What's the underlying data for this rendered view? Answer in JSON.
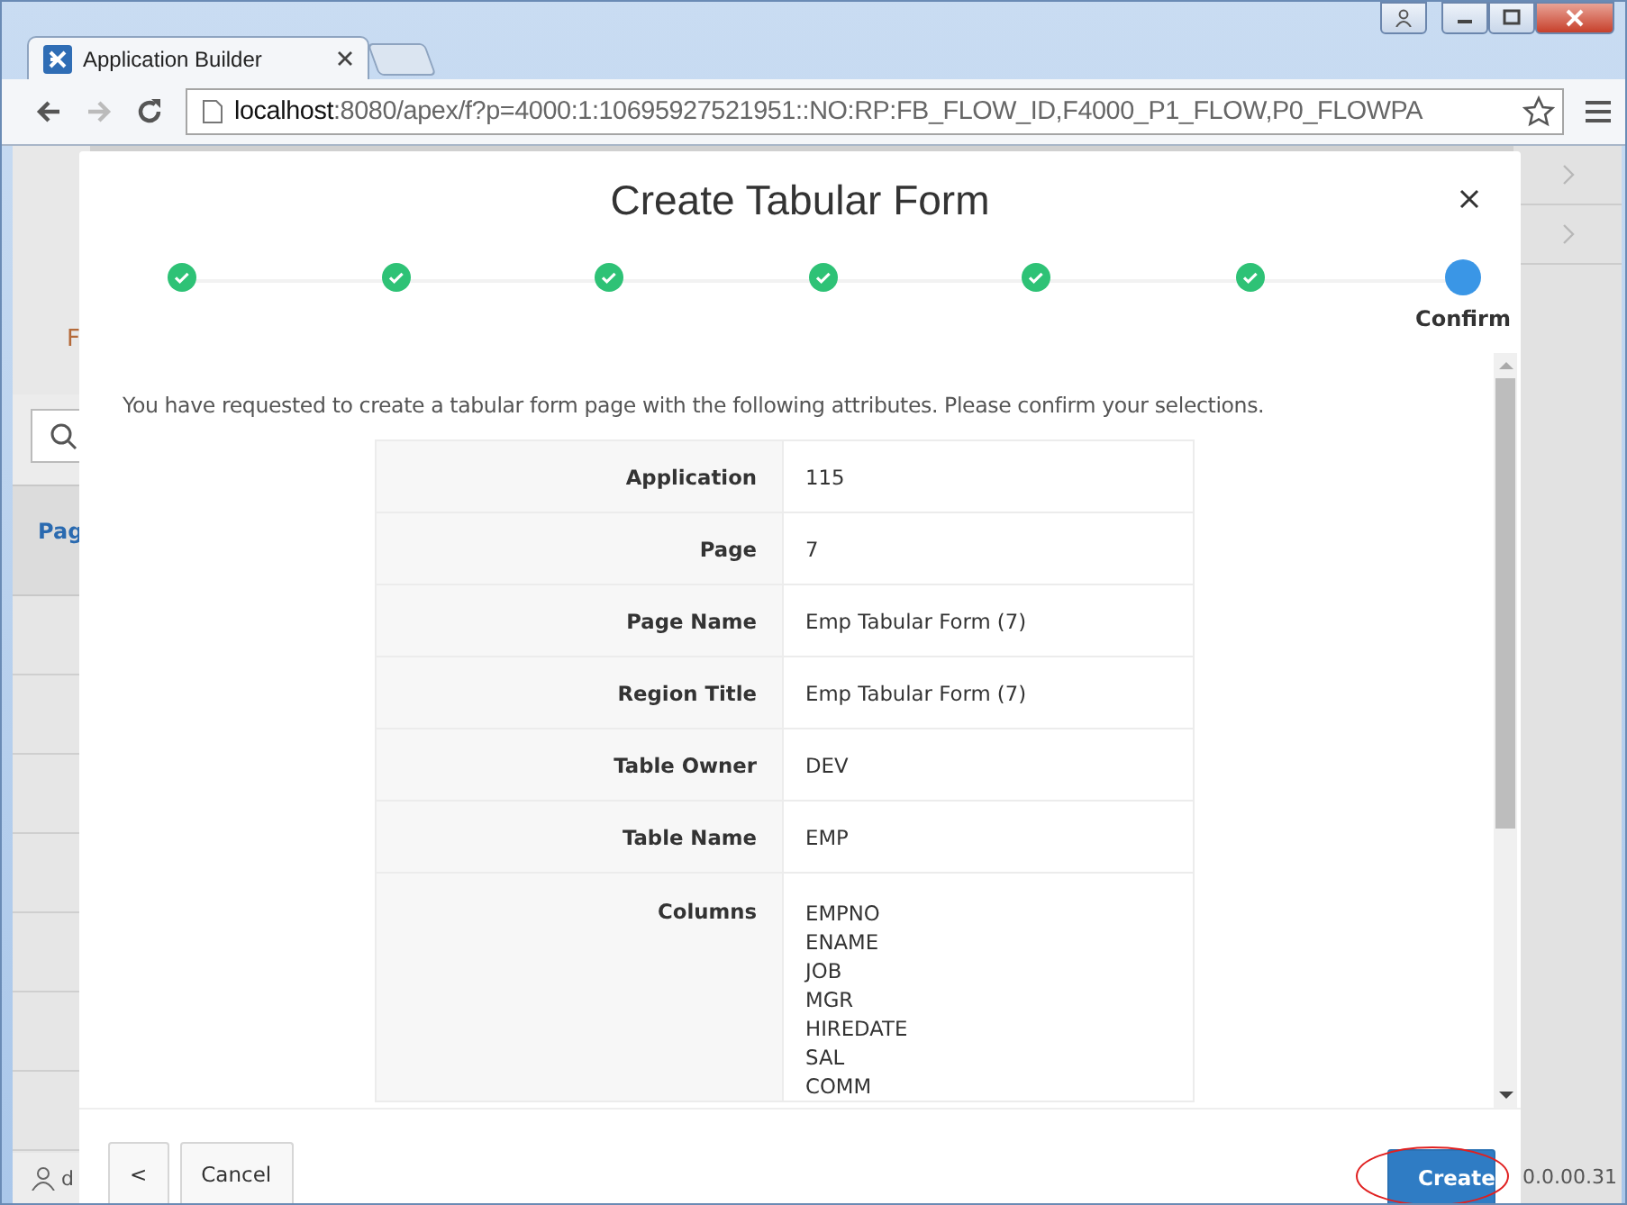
{
  "browser": {
    "tab_title": "Application Builder",
    "url_host": "localhost",
    "url_rest": ":8080/apex/f?p=4000:1:10695927521951::NO:RP:FB_FLOW_ID,F4000_P1_FLOW,P0_FLOWPA"
  },
  "background": {
    "letter": "F",
    "column_header": "Pag",
    "user_initial": "d",
    "version": "0.0.00.31"
  },
  "dialog": {
    "title": "Create Tabular Form",
    "steps": [
      {
        "kind": "done"
      },
      {
        "kind": "done"
      },
      {
        "kind": "done"
      },
      {
        "kind": "done"
      },
      {
        "kind": "done"
      },
      {
        "kind": "done"
      },
      {
        "kind": "current",
        "label": "Confirm"
      }
    ],
    "intro": "You have requested to create a tabular form page with the following attributes. Please confirm your selections.",
    "attributes": [
      {
        "label": "Application",
        "value": [
          "115"
        ]
      },
      {
        "label": "Page",
        "value": [
          "7"
        ]
      },
      {
        "label": "Page Name",
        "value": [
          "Emp Tabular Form (7)"
        ]
      },
      {
        "label": "Region Title",
        "value": [
          "Emp Tabular Form (7)"
        ]
      },
      {
        "label": "Table Owner",
        "value": [
          "DEV"
        ]
      },
      {
        "label": "Table Name",
        "value": [
          "EMP"
        ]
      },
      {
        "label": "Columns",
        "value": [
          "EMPNO",
          "ENAME",
          "JOB",
          "MGR",
          "HIREDATE",
          "SAL",
          "COMM"
        ]
      }
    ],
    "buttons": {
      "back": "<",
      "cancel": "Cancel",
      "create": "Create"
    }
  }
}
